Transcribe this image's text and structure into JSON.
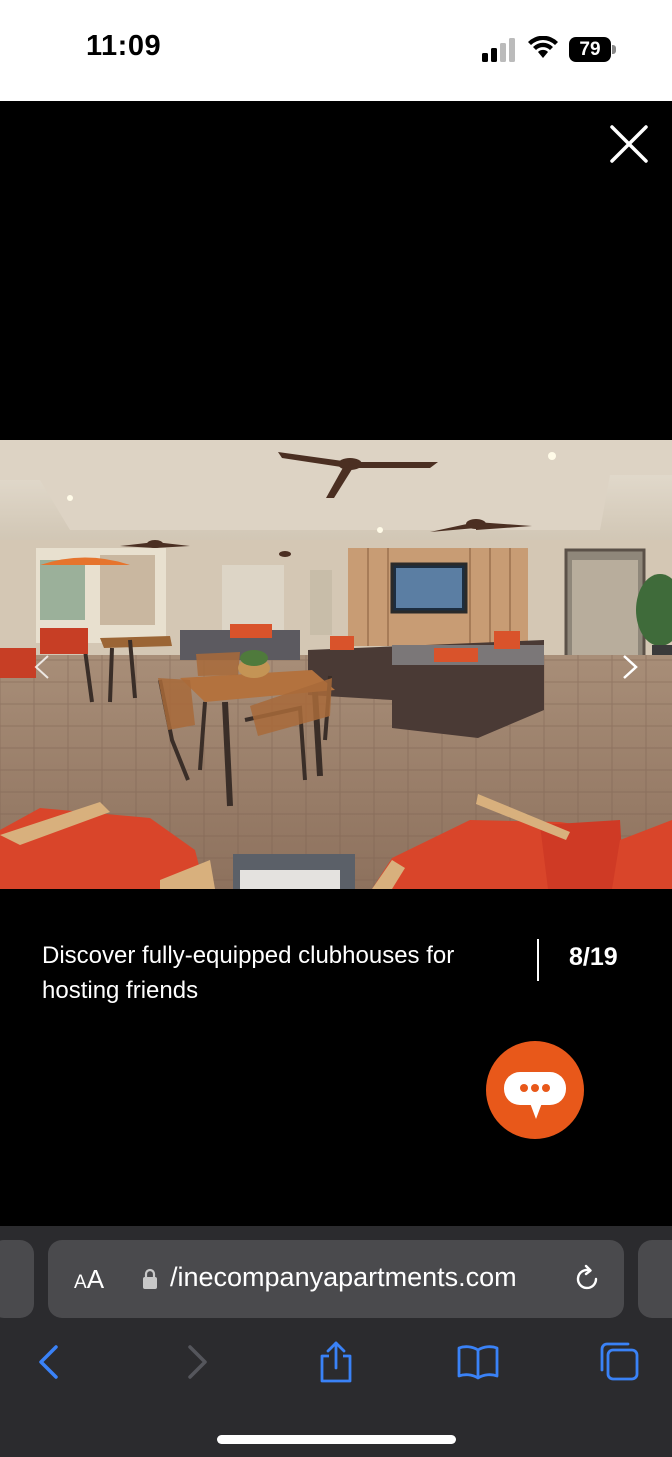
{
  "status": {
    "time": "11:09",
    "battery": "79"
  },
  "viewer": {
    "caption": "Discover fully-equipped clubhouses for hosting friends",
    "counter": "8/19"
  },
  "browser": {
    "aa_small": "A",
    "aa_large": "A",
    "url": "/inecompanyapartments.com"
  },
  "colors": {
    "chat_button": "#e8581a",
    "accent_blue": "#3a82f7"
  },
  "icons": [
    "close-icon",
    "chevron-left-icon",
    "chevron-right-icon",
    "chat-icon",
    "lock-icon",
    "reload-icon",
    "back-icon",
    "forward-icon",
    "share-icon",
    "bookmarks-icon",
    "tabs-icon"
  ]
}
